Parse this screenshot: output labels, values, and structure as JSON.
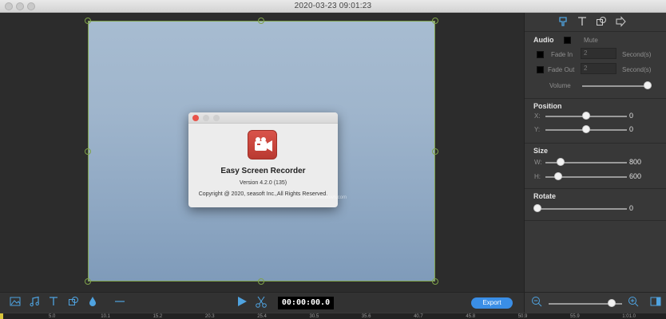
{
  "window": {
    "title": "2020-03-23 09:01:23"
  },
  "about_dialog": {
    "app_name": "Easy Screen Recorder",
    "version": "Version 4.2.0 (135)",
    "copyright": "Copyright @ 2020, seasoft Inc.,All Rights Reserved.",
    "watermark": "www.macdown.com"
  },
  "panel": {
    "tab_icons": [
      "paint-icon",
      "text-icon",
      "shape-icon",
      "arrow-icon"
    ],
    "audio": {
      "title": "Audio",
      "mute_label": "Mute",
      "fade_in_label": "Fade In",
      "fade_in_value": "2",
      "fade_in_unit": "Second(s)",
      "fade_out_label": "Fade Out",
      "fade_out_value": "2",
      "fade_out_unit": "Second(s)",
      "volume_label": "Volume",
      "volume_level": 1.0
    },
    "position": {
      "title": "Position",
      "x_label": "X:",
      "x_value": "0",
      "y_label": "Y:",
      "y_value": "0"
    },
    "size": {
      "title": "Size",
      "w_label": "W:",
      "w_value": "800",
      "h_label": "H:",
      "h_value": "600"
    },
    "rotate": {
      "title": "Rotate",
      "value": "0"
    }
  },
  "toolbar": {
    "tools": [
      "image-icon",
      "music-icon",
      "text-icon",
      "shape-icon",
      "drop-icon",
      "line-icon"
    ],
    "time": "00:00:00.0",
    "export_label": "Export",
    "zoom_level": 0.8
  },
  "ruler": {
    "labels": [
      "5.0",
      "10.1",
      "15.2",
      "20.3",
      "25.4",
      "30.5",
      "35.6",
      "40.7",
      "45.8",
      "50.9",
      "55.9",
      "1:01.0"
    ]
  },
  "colors": {
    "accent": "#3a8ee6",
    "selection": "#7fa24a",
    "app_icon": "#c8443b"
  }
}
